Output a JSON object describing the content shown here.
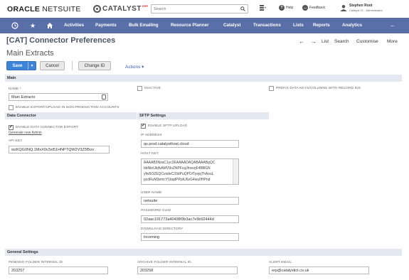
{
  "header": {
    "brand": "ORACLE NETSUITE",
    "brand_part1": "ORACLE",
    "brand_part2": "NETSUITE",
    "logo_text": "CATALYST",
    "logo_sup": "ERP",
    "search_placeholder": "Search",
    "help_label": "Help",
    "feedback_label": "Feedback",
    "user_name": "Stephen Root",
    "user_role": "Catalyst 21 - Administrator"
  },
  "nav": {
    "items": [
      "Activities",
      "Payments",
      "Bulk Emailing",
      "Resource Planner",
      "Catalyst",
      "Transactions",
      "Lists",
      "Reports",
      "Analytics"
    ],
    "more": "..."
  },
  "page": {
    "title": "[CAT] Connector Preferences",
    "record_name": "Main Extracts",
    "links": {
      "list": "List",
      "search": "Search",
      "customise": "Customise",
      "more": "More"
    }
  },
  "buttons": {
    "save": "Save",
    "cancel": "Cancel",
    "change_id": "Change ID",
    "actions": "Actions"
  },
  "main": {
    "section_title": "Main",
    "name_label": "NAME",
    "name_value": "Main Extracts",
    "inactive_label": "INACTIVE",
    "prefix_label": "PREFIX DATA KEYS/COLUMNS WITH RECORD IDS",
    "enable_export_label": "ENABLE EXPORT/UPLOAD IN NON-PRODUCTION ACCOUNTS"
  },
  "data_connector": {
    "section_title": "Data Connector",
    "enable_export_label": "ENABLE DATA CONNECTOR EXPORT",
    "generate_link": "Generate new Admin",
    "api_key_label": "API KEY",
    "api_key_value": "wzKQG0NQ.1MxX0v3xt51HNPTQW2V3Z5f5ov"
  },
  "sftp": {
    "section_title": "SFTP Settings",
    "enable_upload_label": "ENABLE SFTP UPLOAD",
    "ip_label": "IP ADDRESS",
    "ip_value": "qs.prod.catalysthost.cloud",
    "host_key_label": "HOST KEY",
    "host_key_lines": [
      "AAAAB3NzaC1yc2EAAAADAQABAAABgQC",
      "bbNleUbjfvAMV9nZNPFcqJhnezjF4BBGN",
      "yfw5OZEQCvsdeC33dPuQPOiTyejqThAouL",
      "pcdRuM3emcY1bqdPPpIU6zG4wu0HPnd"
    ],
    "user_label": "USER NAME",
    "user_value": "netsuite",
    "password_label": "PASSWORD GUID",
    "password_value": "02aac191773a40498f3b3ac7e9b92444d",
    "dir_label": "DOWNLOAD DIRECTORY",
    "dir_value": "incoming"
  },
  "general": {
    "section_title": "General Settings",
    "pending_label": "PENDING FOLDER INTERNAL ID",
    "pending_value": "203257",
    "archive_label": "ARCHIVE FOLDER INTERNAL ID",
    "archive_value": "203258",
    "alert_label": "ALERT EMAIL",
    "alert_value": "erp@catalystict.co.uk"
  },
  "colors": {
    "nav_bg": "#5a6fa7",
    "save_btn": "#3e84d8",
    "section_bg": "#e4e8f0",
    "title": "#4b5568"
  }
}
